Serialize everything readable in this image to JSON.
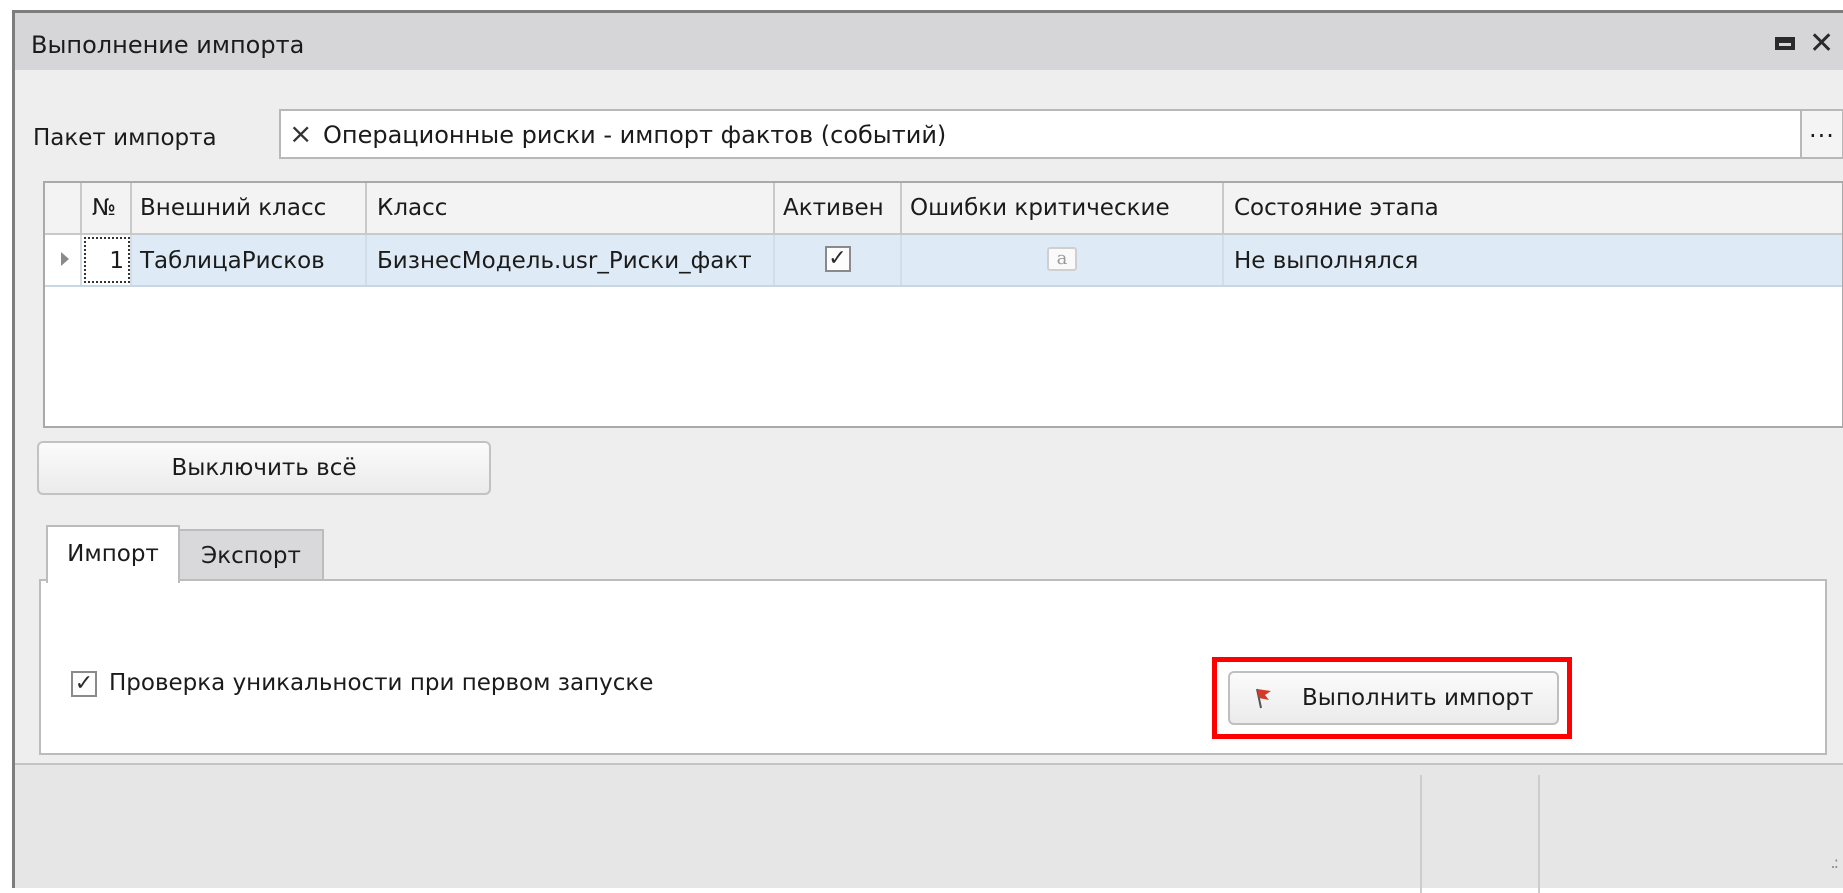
{
  "window": {
    "title": "Выполнение импорта"
  },
  "package": {
    "label": "Пакет импорта",
    "clear_icon": "×",
    "value": "Операционные риски - импорт фактов (событий)",
    "browse_label": "..."
  },
  "grid": {
    "columns": [
      "№",
      "Внешний класс",
      "Класс",
      "Активен",
      "Ошибки критические",
      "Состояние этапа"
    ],
    "rows": [
      {
        "num": "1",
        "external_class": "ТаблицаРисков",
        "class": "БизнесМодель.usr_Риски_факт",
        "active": true,
        "active_mark": "✓",
        "critical_errors_icon": "a",
        "stage_state": "Не выполнялся"
      }
    ]
  },
  "buttons": {
    "disable_all": "Выключить всё",
    "run_import": "Выполнить импорт"
  },
  "tabs": [
    {
      "label": "Импорт",
      "active": true
    },
    {
      "label": "Экспорт",
      "active": false
    }
  ],
  "options": {
    "uniqueness_check": {
      "label": "Проверка уникальности при первом запуске",
      "checked": true,
      "mark": "✓"
    }
  },
  "colors": {
    "highlight": "#ff0000",
    "selected_row": "#deebf6",
    "flag": "#d23a2a"
  },
  "icons": {
    "maximize": "maximize-icon",
    "close": "close-icon",
    "run": "flag-icon"
  }
}
